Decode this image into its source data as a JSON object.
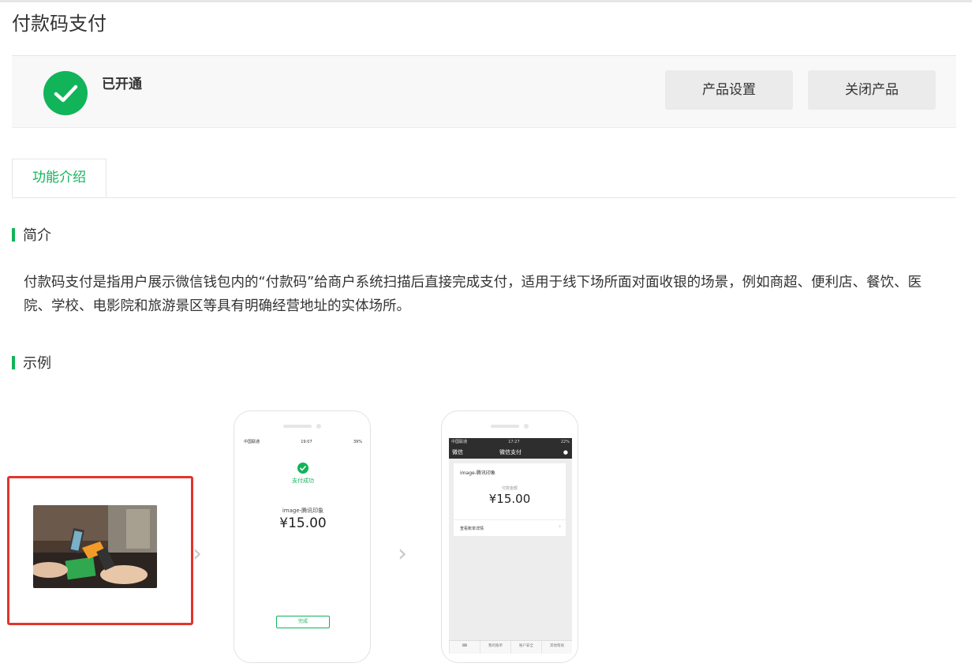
{
  "page": {
    "title": "付款码支付"
  },
  "status": {
    "label": "已开通",
    "color": "#12b45a"
  },
  "actions": {
    "settings_label": "产品设置",
    "close_label": "关闭产品"
  },
  "tabs": [
    {
      "label": "功能介绍",
      "active": true
    }
  ],
  "intro": {
    "heading": "简介",
    "body": "付款码支付是指用户展示微信钱包内的“付款码”给商户系统扫描后直接完成支付，适用于线下场所面对面收银的场景，例如商超、便利店、餐饮、医院、学校、电影院和旅游景区等具有明确经营地址的实体场所。"
  },
  "example": {
    "heading": "示例",
    "phone1": {
      "statusbar_left": "中国联通",
      "statusbar_time": "19:07",
      "statusbar_right": "39%",
      "paid_label": "支付成功",
      "merchant": "image-腾讯印象",
      "amount": "¥15.00",
      "done_label": "完成"
    },
    "phone2": {
      "statusbar_left": "中国联通",
      "statusbar_time": "17:27",
      "statusbar_right": "22%",
      "back_label": "微信",
      "nav_title": "微信支付",
      "merchant": "image-腾讯印象",
      "amount_label": "付款金额",
      "amount": "¥15.00",
      "detail_label": "查看账单详情",
      "tabs": [
        "我的账单",
        "账户安全",
        "其他帮助"
      ]
    }
  }
}
